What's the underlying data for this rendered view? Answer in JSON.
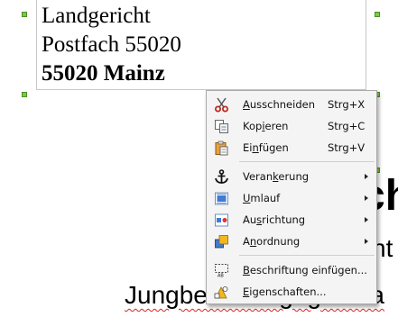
{
  "document": {
    "address_line1": "Landgericht",
    "address_line2": "Postfach 55020",
    "address_line3": "55020 Mainz",
    "bg_heading_fragment": "ch",
    "bg_line2_fragment": "ht",
    "bg_line3_fragment": "Jungbeamter gegen La"
  },
  "context_menu": {
    "items": [
      {
        "pre": "",
        "mn": "A",
        "post": "usschneiden",
        "shortcut": "Strg+X",
        "icon": "scissors-icon"
      },
      {
        "pre": "Kop",
        "mn": "i",
        "post": "eren",
        "shortcut": "Strg+C",
        "icon": "copy-icon"
      },
      {
        "pre": "Ei",
        "mn": "n",
        "post": "fügen",
        "shortcut": "Strg+V",
        "icon": "paste-icon"
      },
      {
        "pre": "Veran",
        "mn": "k",
        "post": "erung",
        "icon": "anchor-icon"
      },
      {
        "pre": "",
        "mn": "U",
        "post": "mlauf",
        "icon": "wrap-icon"
      },
      {
        "pre": "Au",
        "mn": "s",
        "post": "richtung",
        "icon": "align-icon"
      },
      {
        "pre": "A",
        "mn": "n",
        "post": "ordnung",
        "icon": "arrange-icon"
      },
      {
        "pre": "",
        "mn": "B",
        "post": "eschriftung einfügen...",
        "icon": "caption-icon"
      },
      {
        "pre": "",
        "mn": "E",
        "post": "igenschaften...",
        "icon": "properties-icon"
      }
    ]
  },
  "colors": {
    "handle": "#7ac943",
    "menu_bg": "#f4f4f4",
    "spell_underline": "#dd2222"
  }
}
